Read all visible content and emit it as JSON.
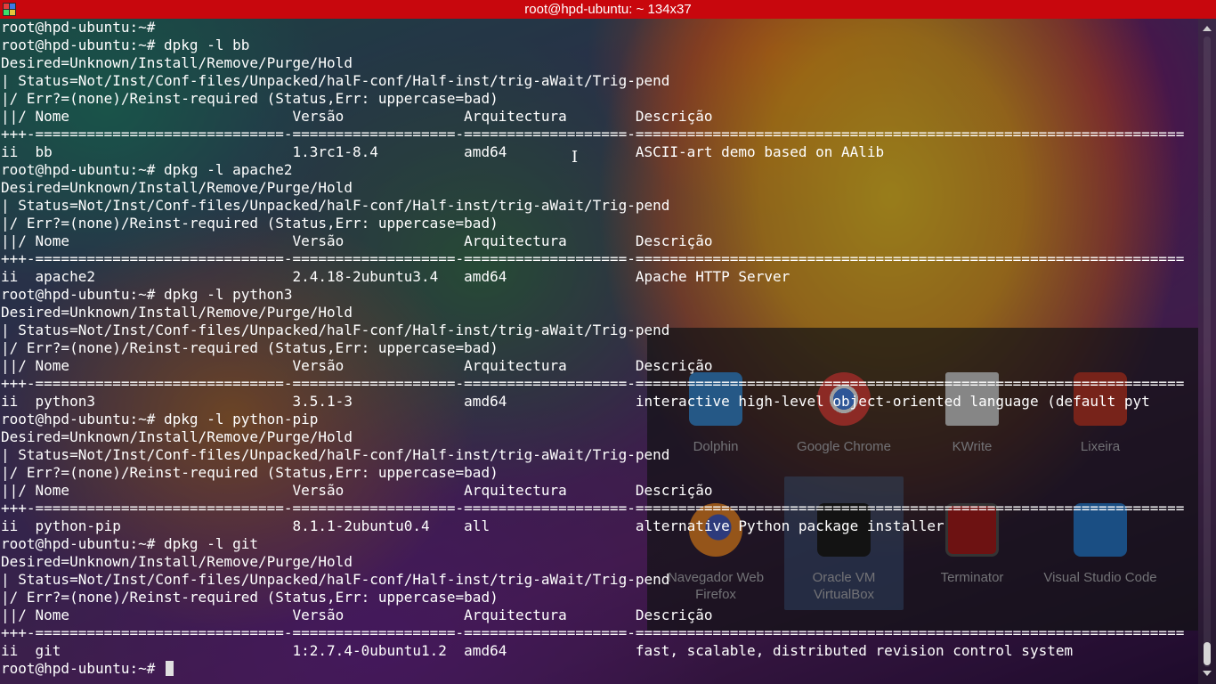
{
  "window": {
    "title": "root@hpd-ubuntu: ~ 134x37"
  },
  "terminal": {
    "lines": [
      "root@hpd-ubuntu:~#",
      "root@hpd-ubuntu:~# dpkg -l bb",
      "Desired=Unknown/Install/Remove/Purge/Hold",
      "| Status=Not/Inst/Conf-files/Unpacked/halF-conf/Half-inst/trig-aWait/Trig-pend",
      "|/ Err?=(none)/Reinst-required (Status,Err: uppercase=bad)",
      "||/ Nome                          Versão              Arquitectura        Descrição",
      "+++-=============================-===================-===================-================================================================",
      "ii  bb                            1.3rc1-8.4          amd64               ASCII-art demo based on AAlib",
      "root@hpd-ubuntu:~# dpkg -l apache2",
      "Desired=Unknown/Install/Remove/Purge/Hold",
      "| Status=Not/Inst/Conf-files/Unpacked/halF-conf/Half-inst/trig-aWait/Trig-pend",
      "|/ Err?=(none)/Reinst-required (Status,Err: uppercase=bad)",
      "||/ Nome                          Versão              Arquitectura        Descrição",
      "+++-=============================-===================-===================-================================================================",
      "ii  apache2                       2.4.18-2ubuntu3.4   amd64               Apache HTTP Server",
      "root@hpd-ubuntu:~# dpkg -l python3",
      "Desired=Unknown/Install/Remove/Purge/Hold",
      "| Status=Not/Inst/Conf-files/Unpacked/halF-conf/Half-inst/trig-aWait/Trig-pend",
      "|/ Err?=(none)/Reinst-required (Status,Err: uppercase=bad)",
      "||/ Nome                          Versão              Arquitectura        Descrição",
      "+++-=============================-===================-===================-================================================================",
      "ii  python3                       3.5.1-3             amd64               interactive high-level object-oriented language (default pyt",
      "root@hpd-ubuntu:~# dpkg -l python-pip",
      "Desired=Unknown/Install/Remove/Purge/Hold",
      "| Status=Not/Inst/Conf-files/Unpacked/halF-conf/Half-inst/trig-aWait/Trig-pend",
      "|/ Err?=(none)/Reinst-required (Status,Err: uppercase=bad)",
      "||/ Nome                          Versão              Arquitectura        Descrição",
      "+++-=============================-===================-===================-================================================================",
      "ii  python-pip                    8.1.1-2ubuntu0.4    all                 alternative Python package installer",
      "root@hpd-ubuntu:~# dpkg -l git",
      "Desired=Unknown/Install/Remove/Purge/Hold",
      "| Status=Not/Inst/Conf-files/Unpacked/halF-conf/Half-inst/trig-aWait/Trig-pend",
      "|/ Err?=(none)/Reinst-required (Status,Err: uppercase=bad)",
      "||/ Nome                          Versão              Arquitectura        Descrição",
      "+++-=============================-===================-===================-================================================================",
      "ii  git                           1:2.7.4-0ubuntu1.2  amd64               fast, scalable, distributed revision control system"
    ],
    "prompt": "root@hpd-ubuntu:~# "
  },
  "launcher": {
    "apps": [
      {
        "name": "Dolphin",
        "icon": "folder-icon",
        "color": "#3d8fd8"
      },
      {
        "name": "Google Chrome",
        "icon": "chrome-icon",
        "color": "#e2453c"
      },
      {
        "name": "KWrite",
        "icon": "text-editor-icon",
        "color": "#d9d9d9"
      },
      {
        "name": "Lixeira",
        "icon": "trash-folder-icon",
        "color": "#c0392b"
      },
      {
        "name": "Navegador Web Firefox",
        "icon": "firefox-icon",
        "color": "#e8743b"
      },
      {
        "name": "Oracle VM VirtualBox",
        "icon": "virtualbox-icon",
        "color": "#1f1f1f"
      },
      {
        "name": "Terminator",
        "icon": "terminal-icon",
        "color": "#b01e1e"
      },
      {
        "name": "Visual Studio Code",
        "icon": "vscode-icon",
        "color": "#2a7fd4"
      }
    ]
  },
  "colors": {
    "titlebar": "#c8070d",
    "text": "#ffffff"
  }
}
